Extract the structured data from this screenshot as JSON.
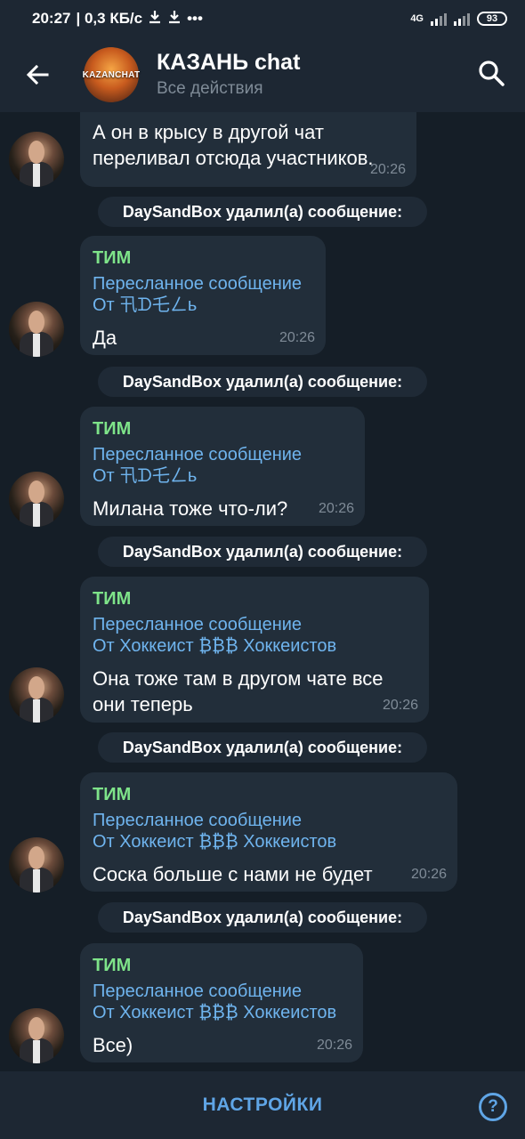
{
  "status_bar": {
    "time": "20:27",
    "speed": "| 0,3 КБ/с",
    "download_icons": [
      "download-icon",
      "download-icon"
    ],
    "more": "•••",
    "network": "4G",
    "battery": "93"
  },
  "header": {
    "title": "КАЗАНЬ chat",
    "subtitle": "Все действия",
    "avatar_text": "KAZANCHAT"
  },
  "messages": [
    {
      "text": "А он в крысу в другой чат переливал отсюда участников.",
      "time": "20:26"
    },
    {
      "service": "DaySandBox удалил(а) сообщение:",
      "sender": "ТИМ",
      "fwd_label": "Пересланное сообщение",
      "fwd_from": "От 卂ᗪ乇ㄥь",
      "text": "Да",
      "time": "20:26"
    },
    {
      "service": "DaySandBox удалил(а) сообщение:",
      "sender": "ТИМ",
      "fwd_label": "Пересланное сообщение",
      "fwd_from": "От 卂ᗪ乇ㄥь",
      "text": "Милана тоже что-ли?",
      "time": "20:26"
    },
    {
      "service": "DaySandBox удалил(а) сообщение:",
      "sender": "ТИМ",
      "fwd_label": "Пересланное сообщение",
      "fwd_from": "От Хоккеист ₿₿₿ Хоккеистов",
      "text": "Она тоже там в другом чате все они теперь",
      "time": "20:26"
    },
    {
      "service": "DaySandBox удалил(а) сообщение:",
      "sender": "ТИМ",
      "fwd_label": "Пересланное сообщение",
      "fwd_from": "От Хоккеист ₿₿₿ Хоккеистов",
      "text": "Соска больше с нами не будет",
      "time": "20:26"
    },
    {
      "service": "DaySandBox удалил(а) сообщение:",
      "sender": "ТИМ",
      "fwd_label": "Пересланное сообщение",
      "fwd_from": "От Хоккеист ₿₿₿ Хоккеистов",
      "text": "Все)",
      "time": "20:26"
    }
  ],
  "bottom_bar": {
    "settings_label": "НАСТРОЙКИ",
    "help_label": "?"
  },
  "colors": {
    "background": "#151e27",
    "bar": "#1d2733",
    "bubble": "#222e3a",
    "sender": "#7ee389",
    "link": "#6fb4ee",
    "muted": "#7f8b97"
  }
}
